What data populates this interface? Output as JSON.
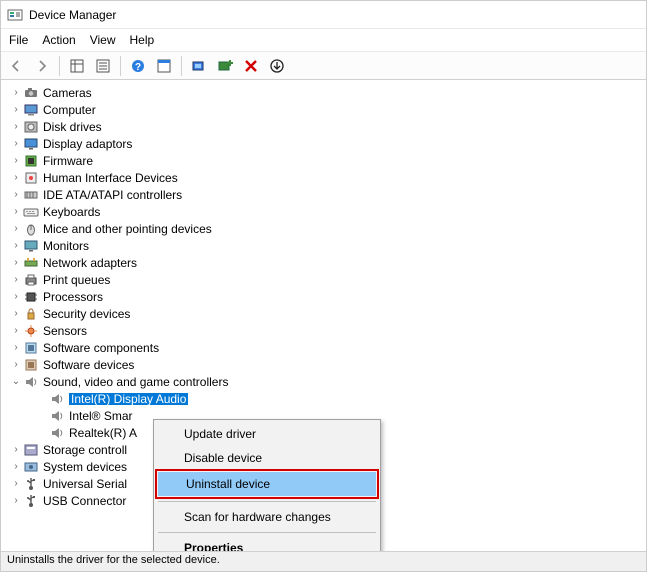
{
  "window": {
    "title": "Device Manager"
  },
  "menubar": {
    "items": [
      "File",
      "Action",
      "View",
      "Help"
    ]
  },
  "toolbar": {
    "buttons": [
      "back-icon",
      "forward-icon",
      "sep",
      "show-hidden-icon",
      "properties-icon",
      "sep",
      "help-icon",
      "action-sheet-icon",
      "sep",
      "scan-hardware-icon",
      "add-legacy-icon",
      "delete-icon",
      "uninstall-icon"
    ]
  },
  "tree": {
    "categories": [
      {
        "label": "Cameras",
        "icon": "camera-icon"
      },
      {
        "label": "Computer",
        "icon": "computer-icon"
      },
      {
        "label": "Disk drives",
        "icon": "disk-icon"
      },
      {
        "label": "Display adaptors",
        "icon": "display-icon"
      },
      {
        "label": "Firmware",
        "icon": "firmware-icon"
      },
      {
        "label": "Human Interface Devices",
        "icon": "hid-icon"
      },
      {
        "label": "IDE ATA/ATAPI controllers",
        "icon": "ide-icon"
      },
      {
        "label": "Keyboards",
        "icon": "keyboard-icon"
      },
      {
        "label": "Mice and other pointing devices",
        "icon": "mouse-icon"
      },
      {
        "label": "Monitors",
        "icon": "monitor-icon"
      },
      {
        "label": "Network adapters",
        "icon": "network-icon"
      },
      {
        "label": "Print queues",
        "icon": "printer-icon"
      },
      {
        "label": "Processors",
        "icon": "processor-icon"
      },
      {
        "label": "Security devices",
        "icon": "security-icon"
      },
      {
        "label": "Sensors",
        "icon": "sensor-icon"
      },
      {
        "label": "Software components",
        "icon": "software-icon"
      },
      {
        "label": "Software devices",
        "icon": "software-dev-icon"
      },
      {
        "label": "Sound, video and game controllers",
        "icon": "sound-icon",
        "expanded": true,
        "children": [
          {
            "label": "Intel(R) Display Audio",
            "icon": "audio-icon",
            "selected": true
          },
          {
            "label": "Intel® Smar",
            "icon": "audio-icon"
          },
          {
            "label": "Realtek(R) A",
            "icon": "audio-icon"
          }
        ]
      },
      {
        "label": "Storage controll",
        "icon": "storage-icon"
      },
      {
        "label": "System devices",
        "icon": "system-icon"
      },
      {
        "label": "Universal Serial ",
        "icon": "usb-icon"
      },
      {
        "label": "USB Connector",
        "icon": "usb-conn-icon"
      }
    ]
  },
  "context_menu": {
    "items": [
      {
        "label": "Update driver",
        "type": "item"
      },
      {
        "label": "Disable device",
        "type": "item"
      },
      {
        "label": "Uninstall device",
        "type": "item",
        "highlighted": true
      },
      {
        "type": "sep"
      },
      {
        "label": "Scan for hardware changes",
        "type": "item"
      },
      {
        "type": "sep"
      },
      {
        "label": "Properties",
        "type": "item",
        "bold": true
      }
    ]
  },
  "statusbar": {
    "text": "Uninstalls the driver for the selected device."
  }
}
